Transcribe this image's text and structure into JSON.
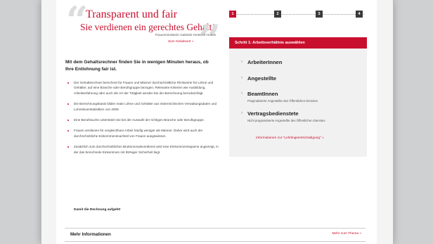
{
  "hero": {
    "title": "Transparent und fair",
    "subtitle": "Sie verdienen ein gerechtes Gehalt!",
    "attribution": "Frauenministerin Gabriele Heinisch-Hosek",
    "link": "Zum Gelaitwort  »"
  },
  "intro": {
    "lead": "Mit dem Gehaltsrechner finden Sie in wenigen Minuten heraus, ob Ihre Entlohnung fair ist.",
    "bullets": [
      "Der Gehaltsrechner berechnet für Frauen und Männer durchschnittliche Richtwerte für Löhne und Gehälter, auf eine Branche oder Berufsgruppe bezogen. Relevante Kriterien wie Ausbildung, Arbeitserfahrung oder auch die Art der Tätigkeit werden bei der Berechnung berücksichtigt.",
      "Die Berechnungsbasis bilden reale Löhne und Gehälter aus österreichischen Verwaltungsdaten und Lohnsteuerstatistiken von 2009.",
      "Eine Berufssuche unterstützt Sie bei der Auswahl der richtigen Branche oder Berufsgruppe.",
      "Frauen verdienen für vergleichbare Arbeit häufig weniger als Männer. Daher wird auch der durchschnittliche Einkommensnachteil von Frauen ausgewiesen.",
      "Zusätzlich zum durchschnittlichen Bruttomonatsverdienst wird eine Einkommensspanne angezeigt, in der das berechnete Einkommen mit 95%iger Sicherheit liegt."
    ],
    "conclusion": "Damit die Rechnung aufgeht!"
  },
  "steps": [
    "1",
    "2",
    "3",
    "4"
  ],
  "panel": {
    "header": "Schritt 1: Arbeitsverhältnis auswählen",
    "options": [
      {
        "label": "ArbeiterInnen",
        "desc": ""
      },
      {
        "label": "Angestellte",
        "desc": ""
      },
      {
        "label": "BeamtInnen",
        "desc": "Pragmatisierte Angestellte des Öffentlichen Dienstes"
      },
      {
        "label": "Vertragsbedienstete",
        "desc": "Nicht pragmatisierte Angestellte des Öffentlichen Dienstes"
      }
    ],
    "link": "Informationen zur \"Lehrlingsentschädigung\"  »"
  },
  "more": {
    "title": "Mehr Informationen",
    "link": "Mehr zum Thema  »"
  },
  "colors": {
    "accent": "#c8102e",
    "step_inactive": "#3a3a3a",
    "panel_bg": "#f1f1f1"
  }
}
